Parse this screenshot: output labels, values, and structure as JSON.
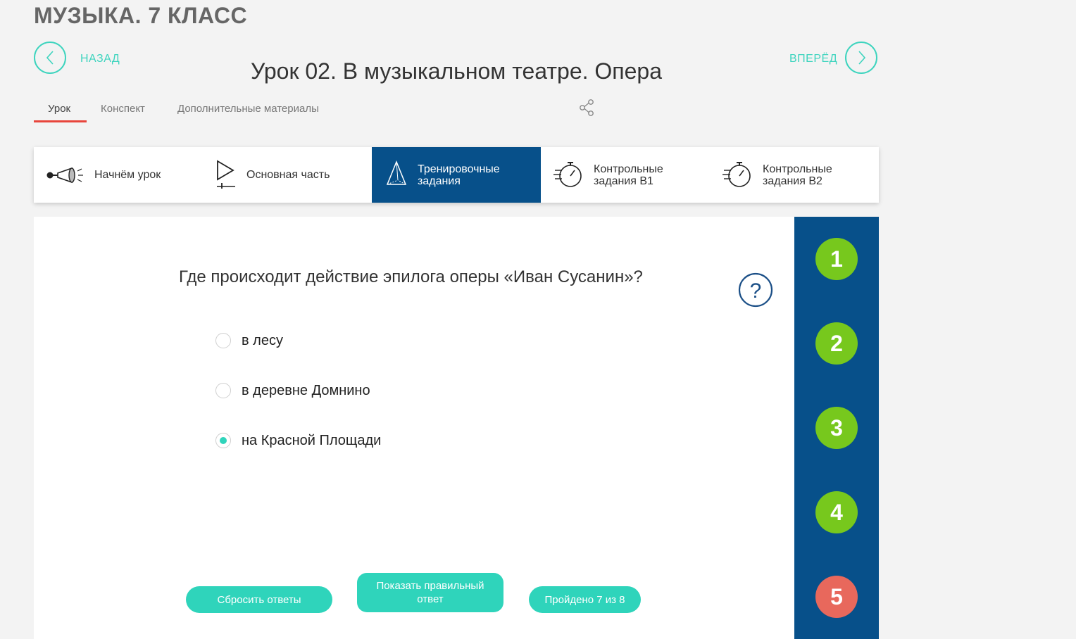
{
  "course_title": "МУЗЫКА. 7 КЛАСС",
  "nav": {
    "back_label": "НАЗАД",
    "forward_label": "ВПЕРЁД"
  },
  "lesson_title": "Урок 02. В музыкальном театре. Опера",
  "tabs": [
    {
      "label": "Урок",
      "active": true
    },
    {
      "label": "Конспект",
      "active": false
    },
    {
      "label": "Дополнительные материалы",
      "active": false
    }
  ],
  "sections": [
    {
      "label_line1": "Начнём урок",
      "label_line2": "",
      "icon": "megaphone-icon",
      "active": false
    },
    {
      "label_line1": "Основная часть",
      "label_line2": "",
      "icon": "play-icon",
      "active": false
    },
    {
      "label_line1": "Тренировочные",
      "label_line2": "задания",
      "icon": "pyramid-icon",
      "active": true
    },
    {
      "label_line1": "Контрольные",
      "label_line2": "задания В1",
      "icon": "stopwatch-icon",
      "active": false
    },
    {
      "label_line1": "Контрольные",
      "label_line2": "задания В2",
      "icon": "stopwatch-icon",
      "active": false
    }
  ],
  "task": {
    "question": "Где происходит действие эпилога оперы «Иван Сусанин»?",
    "options": [
      {
        "label": "в лесу",
        "checked": false
      },
      {
        "label": "в деревне Домнино",
        "checked": false
      },
      {
        "label": "на Красной Площади",
        "checked": true
      }
    ],
    "buttons": {
      "reset": "Сбросить ответы",
      "show_answer_line1": "Показать правильный",
      "show_answer_line2": "ответ",
      "progress": "Пройдено 7 из 8"
    }
  },
  "steps": [
    {
      "label": "1",
      "status": "correct"
    },
    {
      "label": "2",
      "status": "correct"
    },
    {
      "label": "3",
      "status": "correct"
    },
    {
      "label": "4",
      "status": "correct"
    },
    {
      "label": "5",
      "status": "incorrect"
    }
  ],
  "colors": {
    "accent": "#2fd4bb",
    "primary": "#07508a",
    "correct": "#77c81d",
    "incorrect": "#e8685c",
    "tab_underline": "#e8453c"
  }
}
